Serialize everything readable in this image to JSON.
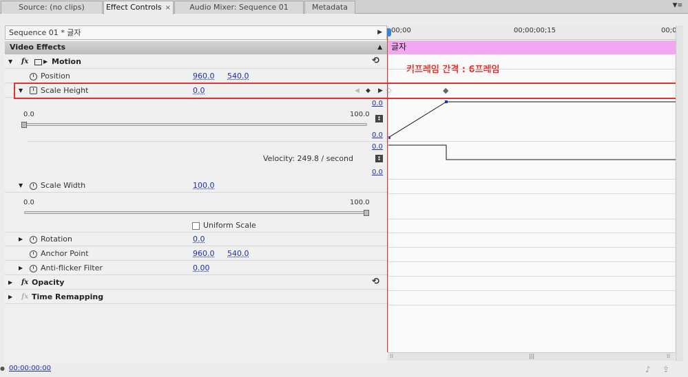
{
  "tabs": [
    {
      "label": "Source: (no clips)"
    },
    {
      "label": "Effect Controls",
      "close": "×"
    },
    {
      "label": "Audio Mixer: Sequence 01"
    },
    {
      "label": "Metadata"
    }
  ],
  "panel_menu_icon": "▼≡",
  "sequence_header": "Sequence 01 * 글자",
  "section_title": "Video Effects",
  "effects": {
    "motion": {
      "fx": "fx",
      "label": "Motion",
      "position": {
        "label": "Position",
        "x": "960.0",
        "y": "540.0"
      },
      "scale_height": {
        "label": "Scale Height",
        "value": "0.0",
        "slider_min": "0.0",
        "slider_max": "100.0",
        "slider_level": 0,
        "graph_top": "0.0",
        "graph_bottom": "0.0",
        "velocity_top": "0.0",
        "velocity_bottom": "0.0",
        "velocity": "Velocity: 249.8 / second"
      },
      "scale_width": {
        "label": "Scale Width",
        "value": "100.0",
        "slider_min": "0.0",
        "slider_max": "100.0",
        "slider_level": 100
      },
      "uniform_scale": "Uniform Scale",
      "rotation": {
        "label": "Rotation",
        "value": "0.0"
      },
      "anchor_point": {
        "label": "Anchor Point",
        "x": "960.0",
        "y": "540.0"
      },
      "anti_flicker": {
        "label": "Anti-flicker Filter",
        "value": "0.00"
      }
    },
    "opacity": {
      "fx": "fx",
      "label": "Opacity"
    },
    "time_remapping": {
      "fx": "fx",
      "label": "Time Remapping"
    }
  },
  "timeline": {
    "tc_start": "00;00",
    "tc_mid": "00;00;00;15",
    "tc_end": "00;0",
    "clip_name": "글자",
    "annotation": "키프레임 간격 : 6프레임"
  },
  "footer_timecode": "00:00:00:00",
  "colors": {
    "highlight": "#e53030",
    "clip": "#f2a8f0",
    "playhead": "#d63b3b",
    "value_link": "#1a2fa8"
  }
}
